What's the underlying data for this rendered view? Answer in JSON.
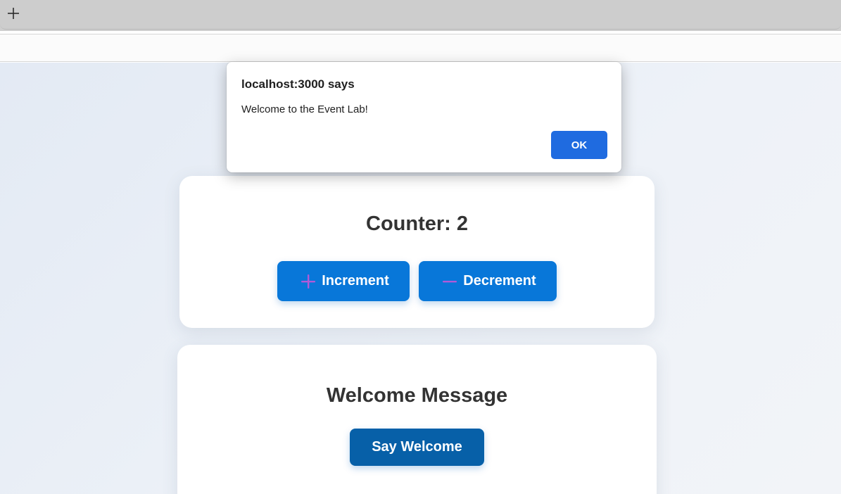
{
  "browser": {
    "new_tab_icon": "plus-icon"
  },
  "dialog": {
    "title": "localhost:3000 says",
    "message": "Welcome to the Event Lab!",
    "ok_label": "OK"
  },
  "counter_card": {
    "title": "Counter: 2",
    "increment_label": "Increment",
    "decrement_label": "Decrement",
    "increment_icon": "plus-emoji-icon",
    "decrement_icon": "minus-emoji-icon",
    "accent": "#0877d9",
    "emoji_color": "#a855f7"
  },
  "welcome_card": {
    "title": "Welcome Message",
    "button_label": "Say Welcome",
    "button_color": "#0760a8"
  }
}
